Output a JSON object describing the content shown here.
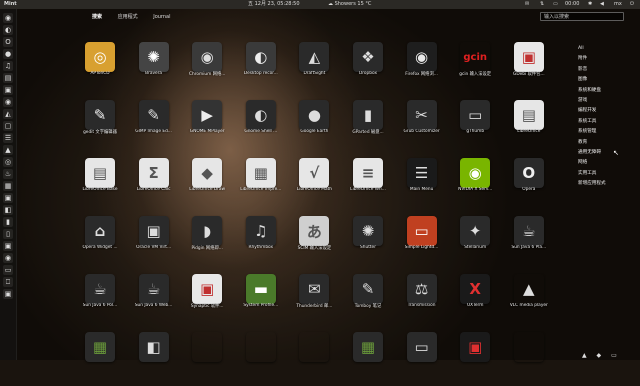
{
  "panel": {
    "app_name": "Mint",
    "datetime": "五 12月 23, 05:28:50",
    "weather": "Showers 15 °C",
    "volume": "00:00",
    "user": "mx"
  },
  "tabs": [
    "搜索",
    "应用程式",
    "Journal"
  ],
  "search": {
    "placeholder": "输入以搜索"
  },
  "apps": [
    {
      "label": "APTonCD",
      "glyph": "◎",
      "bg": "#d8a030",
      "fg": "#fff"
    },
    {
      "label": "Bravera",
      "glyph": "✺",
      "bg": "#444444",
      "fg": "#fff"
    },
    {
      "label": "Chromium 网络...",
      "glyph": "◉",
      "bg": "#3a3a3a",
      "fg": "#ddd"
    },
    {
      "label": "Desktop recor...",
      "glyph": "◐",
      "bg": "#3a3a3a",
      "fg": "#eee"
    },
    {
      "label": "DraftSight",
      "glyph": "◭",
      "bg": "#2a2a2a",
      "fg": "#ddd"
    },
    {
      "label": "Dropbox",
      "glyph": "❖",
      "bg": "#2a2a2a",
      "fg": "#ddd"
    },
    {
      "label": "Firefox 网络浏...",
      "glyph": "◉",
      "bg": "#1e1e1e",
      "fg": "#e8e8e8"
    },
    {
      "label": "gcin 输入法设定",
      "glyph": "gcin",
      "bg": "rgba(0,0,0,0)",
      "fg": "#e02020"
    },
    {
      "label": "GDebi 软件包...",
      "glyph": "▣",
      "bg": "#e8e8e8",
      "fg": "#c03030"
    },
    {
      "label": "gedit 文字编辑器",
      "glyph": "✎",
      "bg": "#2a2a2a",
      "fg": "#eee"
    },
    {
      "label": "GIMP Image Ed...",
      "glyph": "✎",
      "bg": "#2a2a2a",
      "fg": "#ddd"
    },
    {
      "label": "GNOME MPlayer",
      "glyph": "▶",
      "bg": "#333333",
      "fg": "#eee"
    },
    {
      "label": "Gnome Shell ...",
      "glyph": "◐",
      "bg": "#2a2a2a",
      "fg": "#ddd"
    },
    {
      "label": "Google Earth",
      "glyph": "●",
      "bg": "#2a2a2a",
      "fg": "#ddd"
    },
    {
      "label": "GParted 磁盘...",
      "glyph": "▮",
      "bg": "#2a2a2a",
      "fg": "#ddd"
    },
    {
      "label": "Grub Customizer",
      "glyph": "✂",
      "bg": "#2a2a2a",
      "fg": "#ddd"
    },
    {
      "label": "gThumb",
      "glyph": "▭",
      "bg": "#2a2a2a",
      "fg": "#ddd"
    },
    {
      "label": "LibreOffice",
      "glyph": "▤",
      "bg": "#e6e6e6",
      "fg": "#555"
    },
    {
      "label": "LibreOffice Base",
      "glyph": "▤",
      "bg": "#e6e6e6",
      "fg": "#555"
    },
    {
      "label": "LibreOffice Calc",
      "glyph": "Σ",
      "bg": "#e6e6e6",
      "fg": "#555"
    },
    {
      "label": "LibreOffice Draw",
      "glyph": "◆",
      "bg": "#e6e6e6",
      "fg": "#555"
    },
    {
      "label": "LibreOffice Impre...",
      "glyph": "▦",
      "bg": "#e6e6e6",
      "fg": "#555"
    },
    {
      "label": "LibreOffice Math",
      "glyph": "√",
      "bg": "#e6e6e6",
      "fg": "#555"
    },
    {
      "label": "LibreOffice Wri...",
      "glyph": "≡",
      "bg": "#e6e6e6",
      "fg": "#555"
    },
    {
      "label": "Main Menu",
      "glyph": "☰",
      "bg": "#1a1a1a",
      "fg": "#ddd"
    },
    {
      "label": "NVIDIA X Serv...",
      "glyph": "◉",
      "bg": "#79b500",
      "fg": "#fff"
    },
    {
      "label": "Opera",
      "glyph": "O",
      "bg": "#2a2a2a",
      "fg": "#eee"
    },
    {
      "label": "Opera Widget ...",
      "glyph": "⌂",
      "bg": "#2a2a2a",
      "fg": "#ddd"
    },
    {
      "label": "Oracle VM Virt...",
      "glyph": "▣",
      "bg": "#2a2a2a",
      "fg": "#ddd"
    },
    {
      "label": "Pidgin 网络即...",
      "glyph": "◗",
      "bg": "#2a2a2a",
      "fg": "#ddd"
    },
    {
      "label": "Rhythmbox",
      "glyph": "♫",
      "bg": "#2a2a2a",
      "fg": "#ddd"
    },
    {
      "label": "SCIM 输入法设定",
      "glyph": "あ",
      "bg": "#cfcfcf",
      "fg": "#555"
    },
    {
      "label": "Shutter",
      "glyph": "✺",
      "bg": "#2a2a2a",
      "fg": "#ddd"
    },
    {
      "label": "Simple Lightd...",
      "glyph": "▭",
      "bg": "#c04020",
      "fg": "#fff"
    },
    {
      "label": "Stellarium",
      "glyph": "✦",
      "bg": "#2a2a2a",
      "fg": "#ddd"
    },
    {
      "label": "Sun Java 6 Pla...",
      "glyph": "☕",
      "bg": "#2a2a2a",
      "fg": "#ddd"
    },
    {
      "label": "Sun Java 6 Pol...",
      "glyph": "☕",
      "bg": "#2a2a2a",
      "fg": "#ddd"
    },
    {
      "label": "Sun Java 6 Web...",
      "glyph": "☕",
      "bg": "#2a2a2a",
      "fg": "#ddd"
    },
    {
      "label": "Synaptic 软件...",
      "glyph": "▣",
      "bg": "#e8e8e8",
      "fg": "#c03030"
    },
    {
      "label": "System Profile...",
      "glyph": "▬",
      "bg": "#4a7a2a",
      "fg": "#fff"
    },
    {
      "label": "Thunderbird 邮...",
      "glyph": "✉",
      "bg": "#2a2a2a",
      "fg": "#ddd"
    },
    {
      "label": "Tomboy 笔记",
      "glyph": "✎",
      "bg": "#2a2a2a",
      "fg": "#ddd"
    },
    {
      "label": "Transmission",
      "glyph": "⚖",
      "bg": "#2a2a2a",
      "fg": "#ddd"
    },
    {
      "label": "UXTerm",
      "glyph": "X",
      "bg": "#1a1a1a",
      "fg": "#e03030"
    },
    {
      "label": "VLC media player",
      "glyph": "▲",
      "bg": "rgba(0,0,0,0)",
      "fg": "#ddd"
    },
    {
      "label": "",
      "glyph": "▦",
      "bg": "#2a2a2a",
      "fg": "#6a9a3a"
    },
    {
      "label": "",
      "glyph": "◧",
      "bg": "#2a2a2a",
      "fg": "#ddd"
    },
    {
      "label": "",
      "glyph": "",
      "bg": "rgba(0,0,0,0)",
      "fg": "#ddd"
    },
    {
      "label": "",
      "glyph": "",
      "bg": "rgba(0,0,0,0)",
      "fg": "#ddd"
    },
    {
      "label": "",
      "glyph": "",
      "bg": "rgba(0,0,0,0)",
      "fg": "#ddd"
    },
    {
      "label": "",
      "glyph": "▦",
      "bg": "#2a2a2a",
      "fg": "#6a9a3a"
    },
    {
      "label": "",
      "glyph": "▭",
      "bg": "#2a2a2a",
      "fg": "#ddd"
    },
    {
      "label": "",
      "glyph": "▣",
      "bg": "#1a1a1a",
      "fg": "#e03030"
    },
    {
      "label": "",
      "glyph": "",
      "bg": "rgba(0,0,0,0)",
      "fg": "#ddd"
    }
  ],
  "categories": [
    "All",
    "附件",
    "影音",
    "图像",
    "系统和硬盘",
    "游戏",
    "编程开发",
    "系统工具",
    "系统管理",
    "教育",
    "通用无障碍",
    "网络",
    "实用工具",
    "新增应用程式"
  ],
  "launcher": [
    "◉",
    "◐",
    "O",
    "●",
    "♫",
    "▤",
    "▣",
    "◉",
    "◭",
    "▢",
    "☰",
    "▲",
    "◎",
    "♨",
    "▦",
    "▣",
    "◧",
    "▮",
    "▯",
    "▣",
    "◉",
    "▭",
    "⎕",
    "▣"
  ]
}
